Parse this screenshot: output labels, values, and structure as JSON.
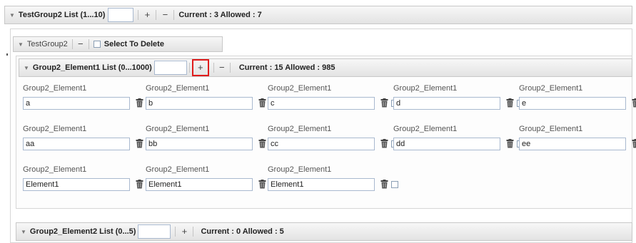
{
  "top_bar": {
    "title": "TestGroup2 List (1...10)",
    "add": "+",
    "remove": "−",
    "status": "Current : 3 Allowed : 7"
  },
  "group_bar": {
    "title": "TestGroup2",
    "remove": "−",
    "select_delete": "Select To Delete"
  },
  "element1_bar": {
    "title": "Group2_Element1 List (0...1000)",
    "add": "+",
    "remove": "−",
    "status": "Current : 15 Allowed : 985"
  },
  "field_label": "Group2_Element1",
  "rows": [
    [
      "a",
      "b",
      "c",
      "d",
      "e"
    ],
    [
      "aa",
      "bb",
      "cc",
      "dd",
      "ee"
    ],
    [
      "Element1",
      "Element1",
      "Element1"
    ]
  ],
  "element2_bar": {
    "title": "Group2_Element2 List (0...5)",
    "add": "+",
    "status": "Current : 0 Allowed : 5"
  },
  "icons": {
    "collapse": "chevron-down-icon",
    "delete": "trash-icon"
  },
  "colors": {
    "highlight": "#e01c1c",
    "input_border": "#a9b9cf"
  }
}
